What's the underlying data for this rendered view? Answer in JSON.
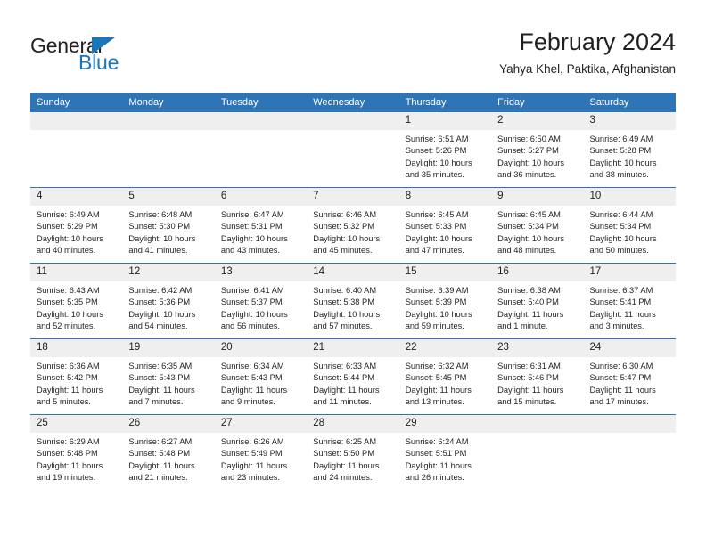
{
  "brand": {
    "name_part1": "General",
    "name_part2": "Blue",
    "accent_color": "#1b75bb"
  },
  "header": {
    "title": "February 2024",
    "subtitle": "Yahya Khel, Paktika, Afghanistan"
  },
  "calendar": {
    "header_bg": "#2f74b5",
    "daynum_bg": "#efefef",
    "weekdays": [
      "Sunday",
      "Monday",
      "Tuesday",
      "Wednesday",
      "Thursday",
      "Friday",
      "Saturday"
    ],
    "weeks": [
      [
        {
          "day": "",
          "sunrise": "",
          "sunset": "",
          "daylight": ""
        },
        {
          "day": "",
          "sunrise": "",
          "sunset": "",
          "daylight": ""
        },
        {
          "day": "",
          "sunrise": "",
          "sunset": "",
          "daylight": ""
        },
        {
          "day": "",
          "sunrise": "",
          "sunset": "",
          "daylight": ""
        },
        {
          "day": "1",
          "sunrise": "Sunrise: 6:51 AM",
          "sunset": "Sunset: 5:26 PM",
          "daylight": "Daylight: 10 hours and 35 minutes."
        },
        {
          "day": "2",
          "sunrise": "Sunrise: 6:50 AM",
          "sunset": "Sunset: 5:27 PM",
          "daylight": "Daylight: 10 hours and 36 minutes."
        },
        {
          "day": "3",
          "sunrise": "Sunrise: 6:49 AM",
          "sunset": "Sunset: 5:28 PM",
          "daylight": "Daylight: 10 hours and 38 minutes."
        }
      ],
      [
        {
          "day": "4",
          "sunrise": "Sunrise: 6:49 AM",
          "sunset": "Sunset: 5:29 PM",
          "daylight": "Daylight: 10 hours and 40 minutes."
        },
        {
          "day": "5",
          "sunrise": "Sunrise: 6:48 AM",
          "sunset": "Sunset: 5:30 PM",
          "daylight": "Daylight: 10 hours and 41 minutes."
        },
        {
          "day": "6",
          "sunrise": "Sunrise: 6:47 AM",
          "sunset": "Sunset: 5:31 PM",
          "daylight": "Daylight: 10 hours and 43 minutes."
        },
        {
          "day": "7",
          "sunrise": "Sunrise: 6:46 AM",
          "sunset": "Sunset: 5:32 PM",
          "daylight": "Daylight: 10 hours and 45 minutes."
        },
        {
          "day": "8",
          "sunrise": "Sunrise: 6:45 AM",
          "sunset": "Sunset: 5:33 PM",
          "daylight": "Daylight: 10 hours and 47 minutes."
        },
        {
          "day": "9",
          "sunrise": "Sunrise: 6:45 AM",
          "sunset": "Sunset: 5:34 PM",
          "daylight": "Daylight: 10 hours and 48 minutes."
        },
        {
          "day": "10",
          "sunrise": "Sunrise: 6:44 AM",
          "sunset": "Sunset: 5:34 PM",
          "daylight": "Daylight: 10 hours and 50 minutes."
        }
      ],
      [
        {
          "day": "11",
          "sunrise": "Sunrise: 6:43 AM",
          "sunset": "Sunset: 5:35 PM",
          "daylight": "Daylight: 10 hours and 52 minutes."
        },
        {
          "day": "12",
          "sunrise": "Sunrise: 6:42 AM",
          "sunset": "Sunset: 5:36 PM",
          "daylight": "Daylight: 10 hours and 54 minutes."
        },
        {
          "day": "13",
          "sunrise": "Sunrise: 6:41 AM",
          "sunset": "Sunset: 5:37 PM",
          "daylight": "Daylight: 10 hours and 56 minutes."
        },
        {
          "day": "14",
          "sunrise": "Sunrise: 6:40 AM",
          "sunset": "Sunset: 5:38 PM",
          "daylight": "Daylight: 10 hours and 57 minutes."
        },
        {
          "day": "15",
          "sunrise": "Sunrise: 6:39 AM",
          "sunset": "Sunset: 5:39 PM",
          "daylight": "Daylight: 10 hours and 59 minutes."
        },
        {
          "day": "16",
          "sunrise": "Sunrise: 6:38 AM",
          "sunset": "Sunset: 5:40 PM",
          "daylight": "Daylight: 11 hours and 1 minute."
        },
        {
          "day": "17",
          "sunrise": "Sunrise: 6:37 AM",
          "sunset": "Sunset: 5:41 PM",
          "daylight": "Daylight: 11 hours and 3 minutes."
        }
      ],
      [
        {
          "day": "18",
          "sunrise": "Sunrise: 6:36 AM",
          "sunset": "Sunset: 5:42 PM",
          "daylight": "Daylight: 11 hours and 5 minutes."
        },
        {
          "day": "19",
          "sunrise": "Sunrise: 6:35 AM",
          "sunset": "Sunset: 5:43 PM",
          "daylight": "Daylight: 11 hours and 7 minutes."
        },
        {
          "day": "20",
          "sunrise": "Sunrise: 6:34 AM",
          "sunset": "Sunset: 5:43 PM",
          "daylight": "Daylight: 11 hours and 9 minutes."
        },
        {
          "day": "21",
          "sunrise": "Sunrise: 6:33 AM",
          "sunset": "Sunset: 5:44 PM",
          "daylight": "Daylight: 11 hours and 11 minutes."
        },
        {
          "day": "22",
          "sunrise": "Sunrise: 6:32 AM",
          "sunset": "Sunset: 5:45 PM",
          "daylight": "Daylight: 11 hours and 13 minutes."
        },
        {
          "day": "23",
          "sunrise": "Sunrise: 6:31 AM",
          "sunset": "Sunset: 5:46 PM",
          "daylight": "Daylight: 11 hours and 15 minutes."
        },
        {
          "day": "24",
          "sunrise": "Sunrise: 6:30 AM",
          "sunset": "Sunset: 5:47 PM",
          "daylight": "Daylight: 11 hours and 17 minutes."
        }
      ],
      [
        {
          "day": "25",
          "sunrise": "Sunrise: 6:29 AM",
          "sunset": "Sunset: 5:48 PM",
          "daylight": "Daylight: 11 hours and 19 minutes."
        },
        {
          "day": "26",
          "sunrise": "Sunrise: 6:27 AM",
          "sunset": "Sunset: 5:48 PM",
          "daylight": "Daylight: 11 hours and 21 minutes."
        },
        {
          "day": "27",
          "sunrise": "Sunrise: 6:26 AM",
          "sunset": "Sunset: 5:49 PM",
          "daylight": "Daylight: 11 hours and 23 minutes."
        },
        {
          "day": "28",
          "sunrise": "Sunrise: 6:25 AM",
          "sunset": "Sunset: 5:50 PM",
          "daylight": "Daylight: 11 hours and 24 minutes."
        },
        {
          "day": "29",
          "sunrise": "Sunrise: 6:24 AM",
          "sunset": "Sunset: 5:51 PM",
          "daylight": "Daylight: 11 hours and 26 minutes."
        },
        {
          "day": "",
          "sunrise": "",
          "sunset": "",
          "daylight": ""
        },
        {
          "day": "",
          "sunrise": "",
          "sunset": "",
          "daylight": ""
        }
      ]
    ]
  }
}
